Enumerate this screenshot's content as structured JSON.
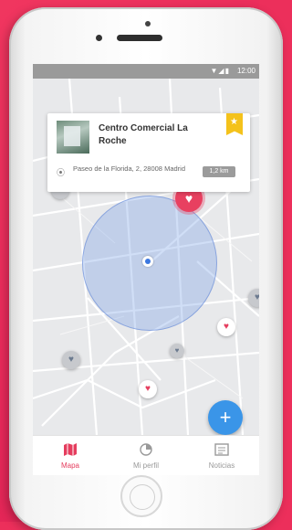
{
  "statusbar": {
    "time": "12:00",
    "icons": "▼◢▮"
  },
  "place_card": {
    "title": "Centro Comercial La Roche",
    "address": "Paseo de la Florida, 2, 28008 Madrid",
    "distance": "1,2 km",
    "bookmark_icon": "star-icon"
  },
  "map": {
    "radius_color": "#78a0e6",
    "marker_color": "#e84060"
  },
  "fab": {
    "label": "+"
  },
  "tabs": [
    {
      "label": "Mapa",
      "icon": "map-icon",
      "active": true
    },
    {
      "label": "Mi perfil",
      "icon": "profile-icon",
      "active": false
    },
    {
      "label": "Noticias",
      "icon": "news-icon",
      "active": false
    }
  ],
  "colors": {
    "accent": "#e53d5e",
    "background": "#ec2f5b",
    "fab": "#3a95e8",
    "bookmark": "#f4c21b"
  }
}
